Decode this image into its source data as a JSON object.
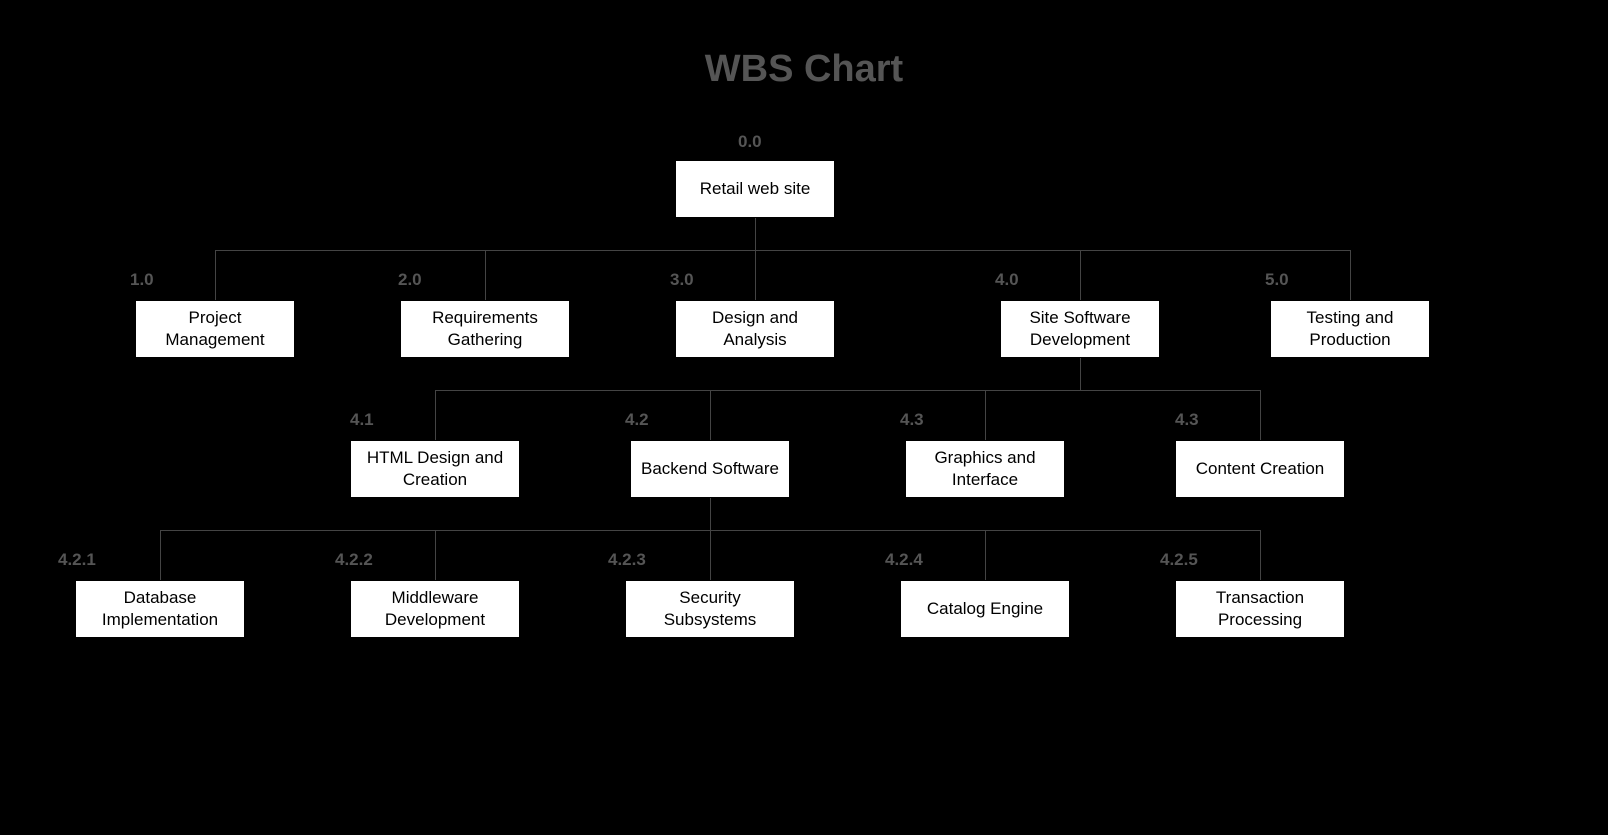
{
  "title": "WBS Chart",
  "root": {
    "code": "0.0",
    "label": "Retail web site"
  },
  "level1": [
    {
      "code": "1.0",
      "label": "Project Management"
    },
    {
      "code": "2.0",
      "label": "Requirements Gathering"
    },
    {
      "code": "3.0",
      "label": "Design and Analysis"
    },
    {
      "code": "4.0",
      "label": "Site Software Development"
    },
    {
      "code": "5.0",
      "label": "Testing and Production"
    }
  ],
  "level2": [
    {
      "code": "4.1",
      "label": "HTML Design and Creation"
    },
    {
      "code": "4.2",
      "label": "Backend Software"
    },
    {
      "code": "4.3",
      "label": "Graphics and Interface"
    },
    {
      "code": "4.3",
      "label": "Content Creation"
    }
  ],
  "level3": [
    {
      "code": "4.2.1",
      "label": "Database Implementation"
    },
    {
      "code": "4.2.2",
      "label": "Middleware Development"
    },
    {
      "code": "4.2.3",
      "label": "Security Subsystems"
    },
    {
      "code": "4.2.4",
      "label": "Catalog Engine"
    },
    {
      "code": "4.2.5",
      "label": "Transaction Processing"
    }
  ]
}
